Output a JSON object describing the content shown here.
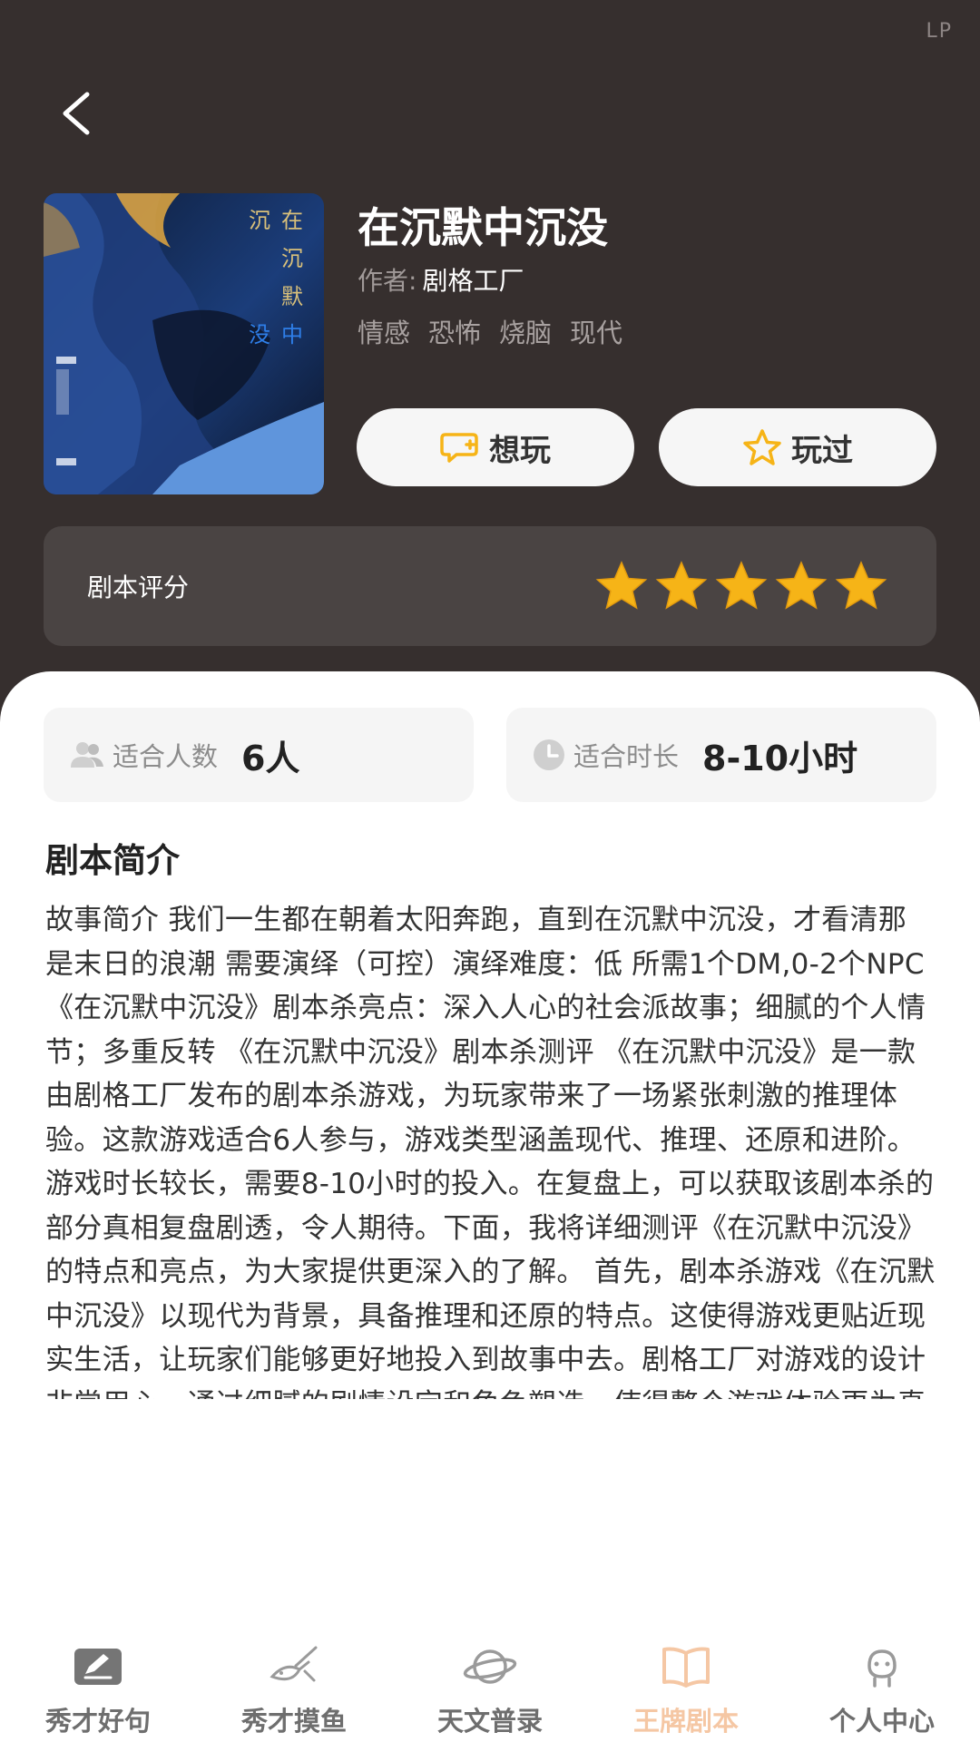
{
  "status": {
    "corner_text": "LP"
  },
  "script": {
    "title": "在沉默中沉没",
    "author_label": "作者:",
    "author": "剧格工厂",
    "tags": [
      "情感",
      "恐怖",
      "烧脑",
      "现代"
    ],
    "cover_title": "沉在沉默没中"
  },
  "actions": {
    "want_label": "想玩",
    "played_label": "玩过"
  },
  "rating": {
    "label": "剧本评分",
    "stars": 5,
    "max_stars": 5
  },
  "info": {
    "players_label": "适合人数",
    "players_value": "6人",
    "duration_label": "适合时长",
    "duration_value": "8-10小时"
  },
  "intro": {
    "title": "剧本简介",
    "text": "故事简介 我们一生都在朝着太阳奔跑，直到在沉默中沉没，才看清那 是末日的浪潮 需要演绎（可控）演绎难度：低 所需1个DM,0-2个NPC 《在沉默中沉没》剧本杀亮点：深入人心的社会派故事；细腻的个人情节；多重反转 《在沉默中沉没》剧本杀测评 《在沉默中沉没》是一款由剧格工厂发布的剧本杀游戏，为玩家带来了一场紧张刺激的推理体验。这款游戏适合6人参与，游戏类型涵盖现代、推理、还原和进阶。游戏时长较长，需要8-10小时的投入。在复盘上，可以获取该剧本杀的部分真相复盘剧透，令人期待。下面，我将详细测评《在沉默中沉没》的特点和亮点，为大家提供更深入的了解。 首先，剧本杀游戏《在沉默中沉没》以现代为背景，具备推理和还原的特点。这使得游戏更贴近现实生活，让玩家们能够更好地投入到故事中去。剧格工厂对游戏的设计非常用心，通过细腻的剧情设定和角色塑造，使得整个游戏体验更为真实而引人入胜。玩家们将扮演不同的角"
  },
  "tabs": [
    {
      "label": "秀才好句",
      "icon": "note-icon"
    },
    {
      "label": "秀才摸鱼",
      "icon": "fish-icon"
    },
    {
      "label": "天文普录",
      "icon": "planet-icon"
    },
    {
      "label": "王牌剧本",
      "icon": "book-icon",
      "active": true
    },
    {
      "label": "个人中心",
      "icon": "person-icon"
    }
  ],
  "colors": {
    "header_bg": "#362f2e",
    "rating_card_bg": "#4a4443",
    "star": "#f6b417",
    "active_tab": "#f5c7a4"
  }
}
